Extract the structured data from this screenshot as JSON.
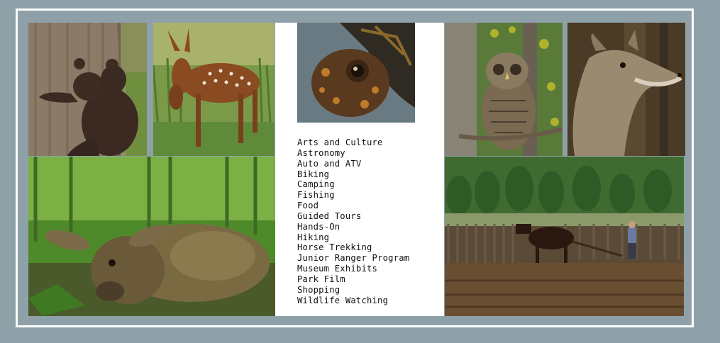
{
  "activities": [
    "Arts and Culture",
    "Astronomy",
    "Auto and ATV",
    "Biking",
    "Camping",
    "Fishing",
    "Food",
    "Guided Tours",
    "Hands-On",
    "Hiking",
    "Horse Trekking",
    "Junior Ranger Program",
    "Museum Exhibits",
    "Park Film",
    "Shopping",
    "Wildlife Watching"
  ],
  "photos": [
    "black-bear-cub-climbing-tree",
    "white-tailed-fawn-in-grass",
    "box-turtle-closeup",
    "barred-owl-on-branch",
    "coyote-in-woods",
    "fawn-resting-in-forest",
    "farmer-plowing-field-with-horse"
  ],
  "colors": {
    "background": "#8fa1a8",
    "frame": "#ffffff",
    "panel": "#ffffff",
    "text": "#111111"
  }
}
